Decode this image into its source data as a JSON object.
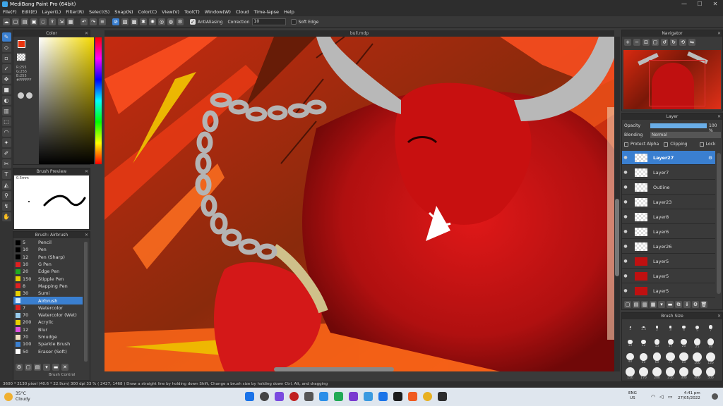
{
  "window": {
    "title": "MediBang Paint Pro (64bit)",
    "min": "—",
    "max": "☐",
    "close": "✕"
  },
  "menu": [
    "File(F)",
    "Edit(E)",
    "Layer(L)",
    "Filter(R)",
    "Select(S)",
    "Snap(N)",
    "Color(C)",
    "View(V)",
    "Tool(T)",
    "Window(W)",
    "Cloud",
    "Time-lapse",
    "Help"
  ],
  "toolbar": {
    "antialiasing_label": "AntiAliasing",
    "correction_label": "Correction",
    "correction_value": "10",
    "soft_edge_label": "Soft Edge"
  },
  "panels": {
    "color": {
      "title": "Color",
      "r": "R:255",
      "g": "G:255",
      "b": "B:255",
      "hex": "#FFFFFF"
    },
    "brush_preview": {
      "title": "Brush Preview",
      "size": "0.5mm"
    },
    "brush": {
      "title": "Brush: Airbrush",
      "footer_tab": "Brush Control"
    },
    "navigator": {
      "title": "Navigator"
    },
    "layer": {
      "title": "Layer",
      "opacity_label": "Opacity",
      "opacity_value": "100 %",
      "blending_label": "Blending",
      "blending_value": "Normal",
      "protect_alpha": "Protect Alpha",
      "clipping": "Clipping",
      "lock": "Lock"
    },
    "brush_size": {
      "title": "Brush Size"
    }
  },
  "brushes": [
    {
      "size": "5",
      "name": "Pencil",
      "color": "#000000"
    },
    {
      "size": "10",
      "name": "Pen",
      "color": "#000000"
    },
    {
      "size": "12",
      "name": "Pen (Sharp)",
      "color": "#000000"
    },
    {
      "size": "10",
      "name": "G Pen",
      "color": "#e02020"
    },
    {
      "size": "20",
      "name": "Edge Pen",
      "color": "#22aa22"
    },
    {
      "size": "150",
      "name": "Stipple Pen",
      "color": "#e8d000"
    },
    {
      "size": "8",
      "name": "Mapping Pen",
      "color": "#e02020"
    },
    {
      "size": "30",
      "name": "Sumi",
      "color": "#e8d000"
    },
    {
      "size": "",
      "name": "Airbrush",
      "color": "#cfe8ff"
    },
    {
      "size": "7",
      "name": "Watercolor",
      "color": "#e02020"
    },
    {
      "size": "70",
      "name": "Watercolor (Wet)",
      "color": "#99ccee"
    },
    {
      "size": "200",
      "name": "Acrylic",
      "color": "#e8d000"
    },
    {
      "size": "12",
      "name": "Blur",
      "color": "#e050e0"
    },
    {
      "size": "70",
      "name": "Smudge",
      "color": "#f0e0c0"
    },
    {
      "size": "100",
      "name": "Sparkle Brush",
      "color": "#3a7fd0"
    },
    {
      "size": "50",
      "name": "Eraser (Soft)",
      "color": "#ffffff"
    }
  ],
  "layers": [
    {
      "name": "Layer27",
      "selected": true,
      "thumb": "checker"
    },
    {
      "name": "Layer7",
      "selected": false,
      "thumb": "checker"
    },
    {
      "name": "Outline",
      "selected": false,
      "thumb": "checker"
    },
    {
      "name": "Layer23",
      "selected": false,
      "thumb": "checker"
    },
    {
      "name": "Layer8",
      "selected": false,
      "thumb": "checker"
    },
    {
      "name": "Layer6",
      "selected": false,
      "thumb": "checker"
    },
    {
      "name": "Layer26",
      "selected": false,
      "thumb": "checker"
    },
    {
      "name": "Layer5",
      "selected": false,
      "thumb": "red"
    },
    {
      "name": "Layer5",
      "selected": false,
      "thumb": "red"
    },
    {
      "name": "Layer5",
      "selected": false,
      "thumb": "red"
    }
  ],
  "brush_sizes": [
    "1",
    "1.5",
    "2",
    "3",
    "4",
    "5",
    "7",
    "10",
    "12",
    "15",
    "17",
    "20",
    "25",
    "30",
    "40",
    "50",
    "60",
    "70",
    "80",
    "100",
    "120",
    "150",
    "170",
    "200",
    "250",
    "300",
    "400",
    "500"
  ],
  "canvas": {
    "tab_title": "bull.mdp"
  },
  "status": {
    "text": "3600 * 2130 pixel   (40.6 * 22.9cm)   300 dpi   33 %   ( 2427, 1468 )   Draw a straight line by holding down Shift, Change a brush size by holding down Ctrl, Alt, and dragging"
  },
  "taskbar": {
    "weather_temp": "35°C",
    "weather_desc": "Cloudy",
    "lang": "ENG",
    "region": "US",
    "time": "4:41 pm",
    "date": "27/05/2022"
  }
}
